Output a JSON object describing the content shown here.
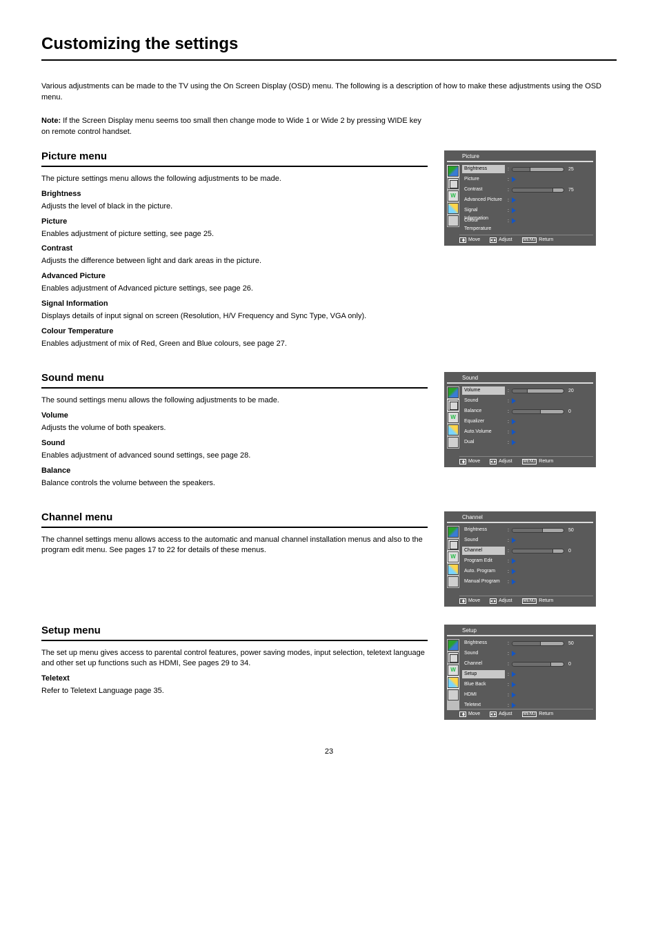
{
  "page": {
    "title": "Customizing the settings",
    "intro": "Various adjustments can be made to the TV using the On Screen Display (OSD) menu. The following is a description of how to make these adjustments using the OSD menu.",
    "note_label": "Note:",
    "note_text": "If the Screen Display menu seems too small then change mode to Wide 1 or Wide 2 by pressing WIDE key on remote control handset.",
    "page_number": "23"
  },
  "osd_footer": {
    "move": "Move",
    "adjust": "Adjust",
    "return": "Return"
  },
  "sections": {
    "picture": {
      "heading": "Picture menu",
      "p1": "The picture settings menu allows the following adjustments to be made.",
      "sub1_h": "Brightness",
      "sub1_t": "Adjusts the level of black in the picture.",
      "sub2_h": "Picture",
      "sub2_t": "Enables adjustment of picture setting, see page 25.",
      "sub3_h": "Contrast",
      "sub3_t": "Adjusts the difference between light and dark areas in the picture.",
      "sub4_h": "Advanced Picture",
      "sub4_t": "Enables adjustment of Advanced picture settings, see page 26.",
      "sub5_h": "Signal Information",
      "sub5_t": "Displays details of input signal on screen (Resolution, H/V Frequency and Sync Type, VGA only).",
      "sub6_h": "Colour Temperature",
      "sub6_t": "Enables adjustment of mix of Red, Green and Blue colours, see page 27."
    },
    "sound": {
      "heading": "Sound menu",
      "p1": "The sound settings menu allows the following adjustments to be made.",
      "sub1_h": "Volume",
      "sub1_t": "Adjusts the volume of both speakers.",
      "sub2_h": "Sound",
      "sub2_t": "Enables adjustment of advanced sound settings, see page 28.",
      "sub3_h": "Balance",
      "sub3_t": "Balance controls the volume between the speakers."
    },
    "channel": {
      "heading": "Channel menu",
      "p1": "The channel settings menu allows access to the automatic and manual channel installation menus and also to the program edit menu. See pages 17 to 22 for details of these menus."
    },
    "setup": {
      "heading": "Setup menu",
      "p1": "The set up menu gives access to parental control features, power saving modes, input selection, teletext language and other set up functions such as HDMI, See pages 29 to 34.",
      "sub1_h": "Teletext",
      "sub1_t": "Refer to Teletext Language page 35."
    }
  },
  "osd": {
    "picture": {
      "title": "Picture",
      "active_index": 0,
      "highlight_tab": 0,
      "rows": [
        {
          "label": "Brightness",
          "slider_fill_pct": 35,
          "value": "25"
        },
        {
          "label": "Picture",
          "arrow": true
        },
        {
          "label": "Contrast",
          "slider_fill_pct": 80,
          "value": "75"
        },
        {
          "label": "Advanced Picture",
          "arrow": true
        },
        {
          "label": "Signal Information",
          "arrow": true
        },
        {
          "label": "Colour Temperature",
          "arrow": true
        }
      ]
    },
    "sound": {
      "title": "Sound",
      "active_index": 0,
      "highlight_tab": 1,
      "rows": [
        {
          "label": "Volume",
          "slider_fill_pct": 30,
          "value": "20"
        },
        {
          "label": "Sound",
          "arrow": true
        },
        {
          "label": "Balance",
          "slider_fill_pct": 55,
          "value": "0"
        },
        {
          "label": "Equalizer",
          "arrow": true
        },
        {
          "label": "Auto.Volume",
          "arrow": true
        },
        {
          "label": "Dual",
          "arrow": true
        }
      ]
    },
    "channel": {
      "title": "Channel",
      "active_index": 2,
      "highlight_tab": 2,
      "rows": [
        {
          "label": "Brightness",
          "slider_fill_pct": 60,
          "value": "50"
        },
        {
          "label": "Sound",
          "arrow": true
        },
        {
          "label": "Channel",
          "slider_fill_pct": 80,
          "value": "0"
        },
        {
          "label": "Program Edit",
          "arrow": true
        },
        {
          "label": "Auto. Program",
          "arrow": true
        },
        {
          "label": "Manual Program",
          "arrow": true
        }
      ]
    },
    "setup": {
      "title": "Setup",
      "active_index": 3,
      "highlight_tab": 3,
      "rows": [
        {
          "label": "Brightness",
          "slider_fill_pct": 55,
          "value": "50"
        },
        {
          "label": "Sound",
          "arrow": true
        },
        {
          "label": "Channel",
          "slider_fill_pct": 75,
          "value": "0"
        },
        {
          "label": "Setup",
          "arrow": true
        },
        {
          "label": "Blue Back",
          "arrow": true
        },
        {
          "label": "HDMI",
          "arrow": true
        },
        {
          "label": "Teletext",
          "arrow": true
        }
      ]
    }
  }
}
